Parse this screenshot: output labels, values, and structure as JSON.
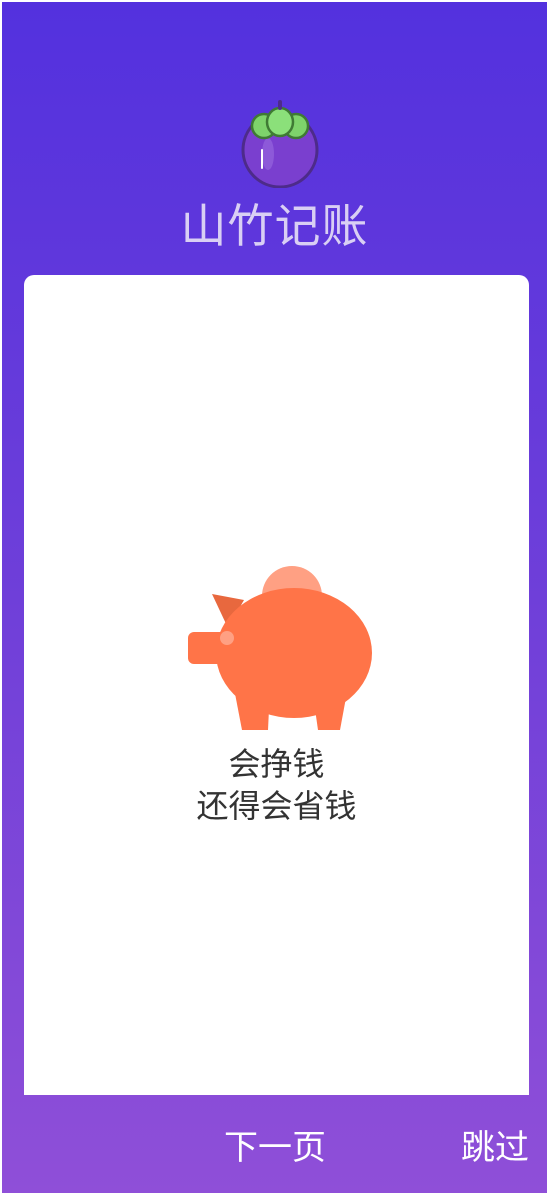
{
  "app": {
    "title": "山竹记账"
  },
  "onboarding": {
    "slogan_line1": "会挣钱",
    "slogan_line2": "还得会省钱"
  },
  "nav": {
    "next_label": "下一页",
    "skip_label": "跳过"
  },
  "icons": {
    "logo": "mangosteen-icon",
    "illustration": "piggy-bank-icon"
  },
  "colors": {
    "bg_top": "#5331de",
    "bg_bottom": "#8f4fd8",
    "pig": "#ff7448",
    "coin": "#ffa083"
  }
}
